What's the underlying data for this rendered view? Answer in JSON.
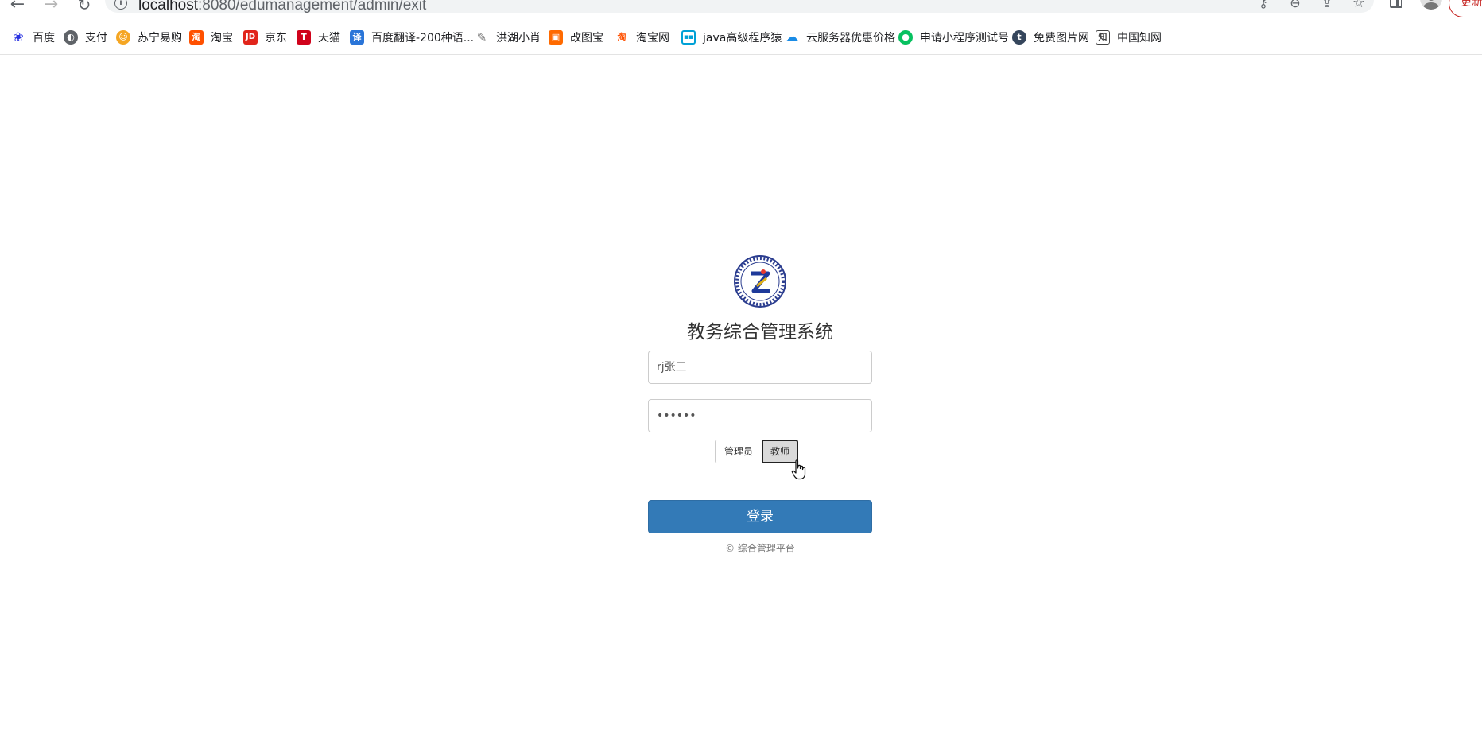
{
  "browser": {
    "url_host": "localhost",
    "url_path": ":8080/edumanagement/admin/exit",
    "update_label": "更新",
    "bookmarks": [
      {
        "label": "百度",
        "icon": "baidu-paw-icon",
        "color": "#2932e1"
      },
      {
        "label": "支付",
        "icon": "globe-icon",
        "color": "#5f6368"
      },
      {
        "label": "苏宁易购",
        "icon": "suning-lion-icon",
        "color": "#f5a623"
      },
      {
        "label": "淘宝",
        "icon": "taobao-icon",
        "color": "#ff5000"
      },
      {
        "label": "京东",
        "icon": "jd-icon",
        "color": "#e1251b"
      },
      {
        "label": "天猫",
        "icon": "tmall-icon",
        "color": "#d0021b"
      },
      {
        "label": "百度翻译-200种语...",
        "icon": "translate-icon",
        "color": "#2a75d8"
      },
      {
        "label": "洪湖小肖",
        "icon": "feather-icon",
        "color": "#777777"
      },
      {
        "label": "改图宝",
        "icon": "gaitubao-icon",
        "color": "#ff6a00"
      },
      {
        "label": "淘宝网",
        "icon": "taobao-net-icon",
        "color": "#ff5000"
      },
      {
        "label": "java高级程序猿",
        "icon": "bilibili-icon",
        "color": "#00a1d6"
      },
      {
        "label": "云服务器优惠价格",
        "icon": "cloud-icon",
        "color": "#1a8ce6"
      },
      {
        "label": "申请小程序测试号",
        "icon": "wechat-icon",
        "color": "#07c160"
      },
      {
        "label": "免费图片网",
        "icon": "tumblr-icon",
        "color": "#35465c"
      },
      {
        "label": "中国知网",
        "icon": "cnki-icon",
        "color": "#444444"
      }
    ]
  },
  "login": {
    "title": "教务综合管理系统",
    "username_value": "rj张三",
    "password_value": "••••••",
    "roles": [
      "管理员",
      "教师"
    ],
    "selected_role": "教师",
    "login_label": "登录",
    "footer": "© 综合管理平台"
  }
}
